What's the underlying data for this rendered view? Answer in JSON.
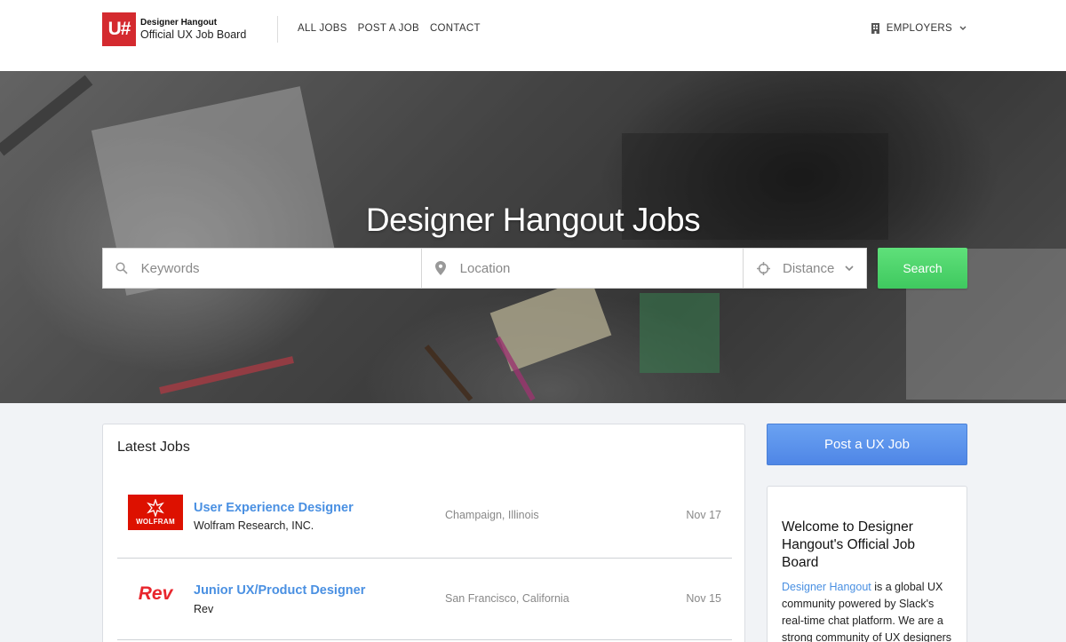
{
  "header": {
    "logo_mark": "U#",
    "logo_top": "Designer Hangout",
    "logo_bottom": "Official UX Job Board",
    "nav": [
      "ALL JOBS",
      "POST A JOB",
      "CONTACT"
    ],
    "employers_label": "EMPLOYERS"
  },
  "hero": {
    "title": "Designer Hangout Jobs",
    "search": {
      "keywords_placeholder": "Keywords",
      "location_placeholder": "Location",
      "distance_label": "Distance",
      "button_label": "Search"
    }
  },
  "jobs": {
    "heading": "Latest Jobs",
    "items": [
      {
        "title": "User Experience Designer",
        "company": "Wolfram Research, INC.",
        "location": "Champaign, Illinois",
        "date": "Nov 17",
        "logo_text": "WOLFRAM"
      },
      {
        "title": "Junior UX/Product Designer",
        "company": "Rev",
        "location": "San Francisco, California",
        "date": "Nov 15",
        "logo_text": "Rev"
      }
    ]
  },
  "sidebar": {
    "post_button": "Post a UX Job",
    "welcome_title": "Welcome to Designer Hangout's Official Job Board",
    "welcome_link": "Designer Hangout",
    "welcome_text": " is a global UX community powered by Slack's real-time chat platform. We are a strong community of UX designers"
  },
  "colors": {
    "brand_red": "#d42a2f",
    "link_blue": "#4a90e2",
    "search_green": "#4cd26b",
    "post_blue": "#5a8fe9"
  }
}
